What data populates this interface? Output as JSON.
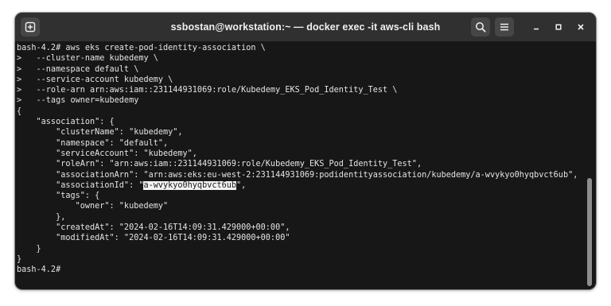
{
  "window": {
    "title": "ssbostan@workstation:~ — docker exec -it aws-cli bash"
  },
  "icons": {
    "new_tab": "new-tab-icon",
    "search": "search-icon",
    "menu": "hamburger-menu-icon",
    "minimize": "minimize-icon",
    "maximize": "maximize-icon",
    "close": "close-icon"
  },
  "colors": {
    "terminal_bg": "#171717",
    "terminal_fg": "#e4e4e4",
    "titlebar_bg": "#303030",
    "selection_bg": "#f2f2f2"
  },
  "terminal": {
    "lines": [
      "bash-4.2# aws eks create-pod-identity-association \\",
      ">   --cluster-name kubedemy \\",
      ">   --namespace default \\",
      ">   --service-account kubedemy \\",
      ">   --role-arn arn:aws:iam::231144931069:role/Kubedemy_EKS_Pod_Identity_Test \\",
      ">   --tags owner=kubedemy",
      "{",
      "    \"association\": {",
      "        \"clusterName\": \"kubedemy\",",
      "        \"namespace\": \"default\",",
      "        \"serviceAccount\": \"kubedemy\",",
      "        \"roleArn\": \"arn:aws:iam::231144931069:role/Kubedemy_EKS_Pod_Identity_Test\",",
      "        \"associationArn\": \"arn:aws:eks:eu-west-2:231144931069:podidentityassociation/kubedemy/a-wvykyo0hyqbvct6ub\",",
      {
        "before": "        \"associationId\": \"",
        "selected": "a-wvykyo0hyqbvct6ub",
        "after": "\","
      },
      "        \"tags\": {",
      "            \"owner\": \"kubedemy\"",
      "        },",
      "        \"createdAt\": \"2024-02-16T14:09:31.429000+00:00\",",
      "        \"modifiedAt\": \"2024-02-16T14:09:31.429000+00:00\"",
      "    }",
      "}",
      "bash-4.2#"
    ]
  }
}
